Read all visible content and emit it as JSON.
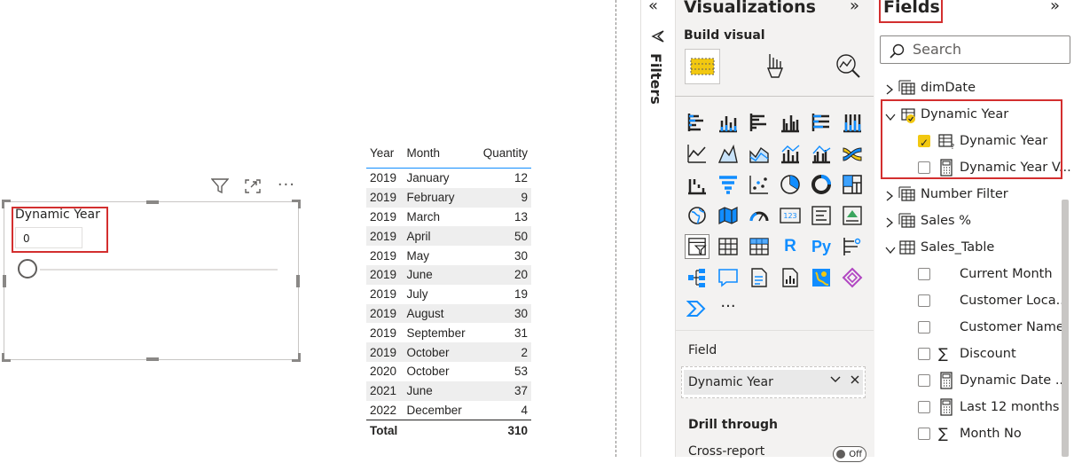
{
  "slicer": {
    "title": "Dynamic Year",
    "value": "0"
  },
  "table": {
    "headers": [
      "Year",
      "Month",
      "Quantity"
    ],
    "rows": [
      [
        "2019",
        "January",
        "12"
      ],
      [
        "2019",
        "February",
        "9"
      ],
      [
        "2019",
        "March",
        "13"
      ],
      [
        "2019",
        "April",
        "50"
      ],
      [
        "2019",
        "May",
        "30"
      ],
      [
        "2019",
        "June",
        "20"
      ],
      [
        "2019",
        "July",
        "19"
      ],
      [
        "2019",
        "August",
        "30"
      ],
      [
        "2019",
        "September",
        "31"
      ],
      [
        "2019",
        "October",
        "2"
      ],
      [
        "2020",
        "October",
        "53"
      ],
      [
        "2021",
        "June",
        "37"
      ],
      [
        "2022",
        "December",
        "4"
      ]
    ],
    "total_label": "Total",
    "total_value": "310"
  },
  "filters": {
    "label": "Filters"
  },
  "visualizations": {
    "title": "Visualizations",
    "build_label": "Build visual",
    "more_label": "···",
    "field_label": "Field",
    "field_value": "Dynamic Year",
    "drill_through_label": "Drill through",
    "cross_report_label": "Cross-report",
    "toggle_label": "Off"
  },
  "fields": {
    "title": "Fields",
    "search_placeholder": "Search",
    "items": [
      {
        "label": "dimDate",
        "kind": "table",
        "expanded": false
      },
      {
        "label": "Dynamic Year",
        "kind": "parameter-table",
        "expanded": true
      },
      {
        "label": "Dynamic Year",
        "kind": "parameter-field",
        "checked": true
      },
      {
        "label": "Dynamic Year V...",
        "kind": "measure",
        "checked": false
      },
      {
        "label": "Number Filter",
        "kind": "table",
        "expanded": false
      },
      {
        "label": "Sales %",
        "kind": "table",
        "expanded": false
      },
      {
        "label": "Sales_Table",
        "kind": "table",
        "expanded": true
      },
      {
        "label": "Current Month",
        "kind": "column",
        "checked": false
      },
      {
        "label": "Customer Loca...",
        "kind": "column",
        "checked": false
      },
      {
        "label": "Customer Name",
        "kind": "column",
        "checked": false
      },
      {
        "label": "Discount",
        "kind": "sum",
        "checked": false
      },
      {
        "label": "Dynamic Date ...",
        "kind": "measure",
        "checked": false
      },
      {
        "label": "Last 12 months",
        "kind": "measure",
        "checked": false
      },
      {
        "label": "Month No",
        "kind": "sum",
        "checked": false
      }
    ]
  },
  "colors": {
    "accent_yellow": "#f2c811",
    "highlight_red": "#d32f2f",
    "table_header_rule": "#118dff"
  }
}
